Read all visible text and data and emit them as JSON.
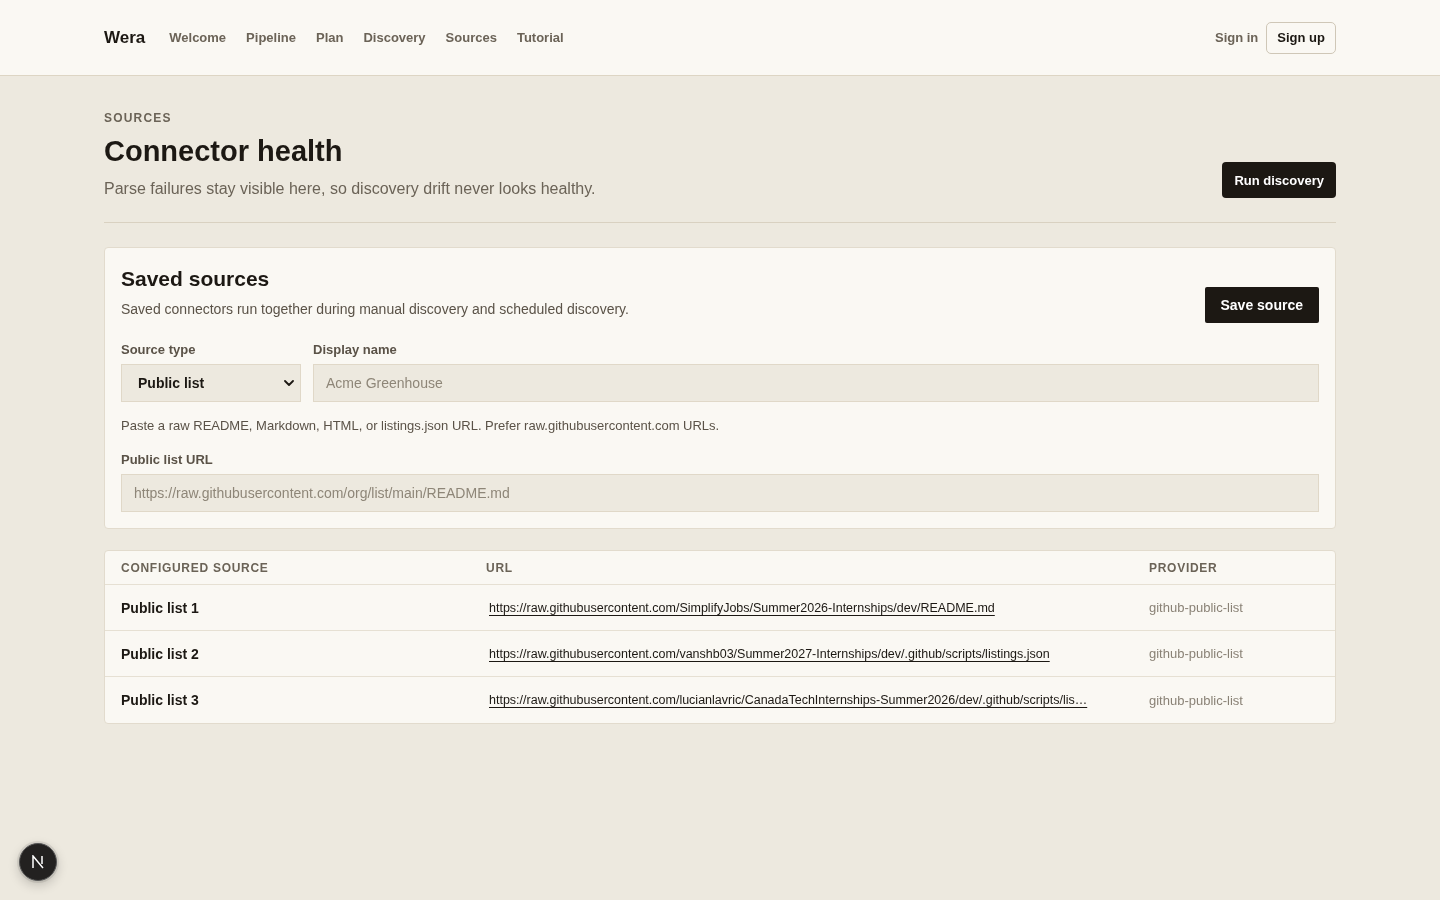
{
  "nav": {
    "brand": "Wera",
    "links": [
      "Welcome",
      "Pipeline",
      "Plan",
      "Discovery",
      "Sources",
      "Tutorial"
    ],
    "sign_in": "Sign in",
    "sign_up": "Sign up"
  },
  "header": {
    "eyebrow": "SOURCES",
    "title": "Connector health",
    "subtitle": "Parse failures stay visible here, so discovery drift never looks healthy.",
    "action": "Run discovery"
  },
  "form": {
    "title": "Saved sources",
    "description": "Saved connectors run together during manual discovery and scheduled discovery.",
    "save": "Save source",
    "source_type": {
      "label": "Source type",
      "value": "Public list"
    },
    "display_name": {
      "label": "Display name",
      "placeholder": "Acme Greenhouse"
    },
    "hint": "Paste a raw README, Markdown, HTML, or listings.json URL. Prefer raw.githubusercontent.com URLs.",
    "url_field": {
      "label": "Public list URL",
      "placeholder": "https://raw.githubusercontent.com/org/list/main/README.md"
    }
  },
  "table": {
    "columns": [
      "CONFIGURED SOURCE",
      "URL",
      "PROVIDER"
    ],
    "rows": [
      {
        "name": "Public list 1",
        "url": "https://raw.githubusercontent.com/SimplifyJobs/Summer2026-Internships/dev/README.md",
        "provider": "github-public-list"
      },
      {
        "name": "Public list 2",
        "url": "https://raw.githubusercontent.com/vanshb03/Summer2027-Internships/dev/.github/scripts/listings.json",
        "provider": "github-public-list"
      },
      {
        "name": "Public list 3",
        "url": "https://raw.githubusercontent.com/lucianlavric/CanadaTechInternships-Summer2026/dev/.github/scripts/lis…",
        "provider": "github-public-list"
      }
    ]
  }
}
